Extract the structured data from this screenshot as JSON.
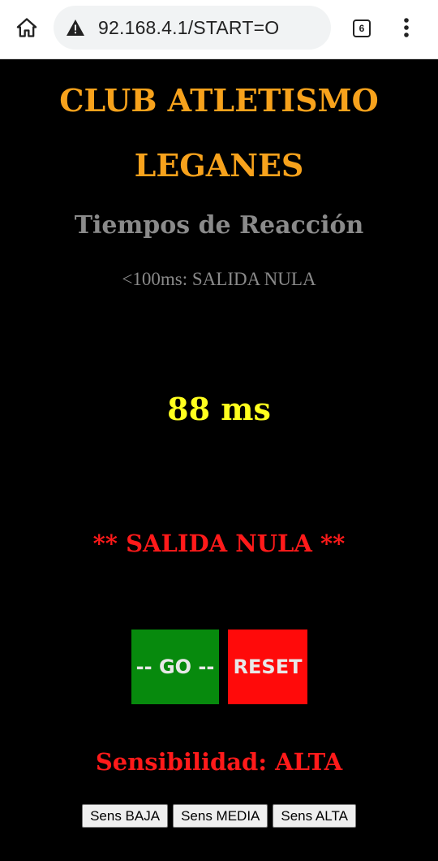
{
  "browser": {
    "url": "92.168.4.1/START=O",
    "tab_count": "6",
    "icons": {
      "home": "home-icon",
      "warning": "warning-icon",
      "tabs": "tabs-icon",
      "menu": "more-vert-icon"
    }
  },
  "page": {
    "title_line1": "CLUB ATLETISMO",
    "title_line2": "LEGANES",
    "subtitle": "Tiempos de Reacción",
    "rule": "<100ms: SALIDA NULA",
    "time": "88 ms",
    "status": "** SALIDA NULA **",
    "go_label": "-- GO --",
    "reset_label": "RESET",
    "sensitivity": "Sensibilidad: ALTA",
    "sens_buttons": [
      "Sens BAJA",
      "Sens MEDIA",
      "Sens ALTA"
    ]
  },
  "colors": {
    "background": "#000000",
    "title": "#f7a21c",
    "subtitle": "#8a8a8a",
    "time": "#ffff1e",
    "alert": "#ff1a1a",
    "go_button": "#078a0d",
    "reset_button": "#ff0a0a"
  }
}
